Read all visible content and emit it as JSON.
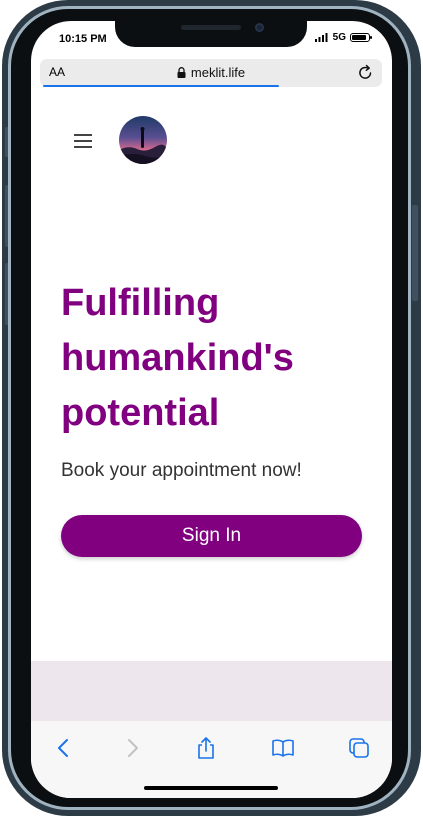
{
  "status_bar": {
    "time": "10:15 PM",
    "network": "5G"
  },
  "browser": {
    "text_size_label": "AA",
    "url": "meklit.life"
  },
  "hero": {
    "headline": "Fulfilling humankind's potential",
    "subtext": "Book your appointment now!",
    "signin_label": "Sign In"
  },
  "colors": {
    "brand": "#800080",
    "link_blue": "#1a73e8",
    "footer_bg": "#ede6ec"
  },
  "icons": {
    "menu": "hamburger-icon",
    "back": "chevron-left-icon",
    "forward": "chevron-right-icon",
    "share": "share-icon",
    "bookmarks": "book-icon",
    "tabs": "tabs-icon",
    "reload": "reload-icon",
    "lock": "lock-icon"
  }
}
